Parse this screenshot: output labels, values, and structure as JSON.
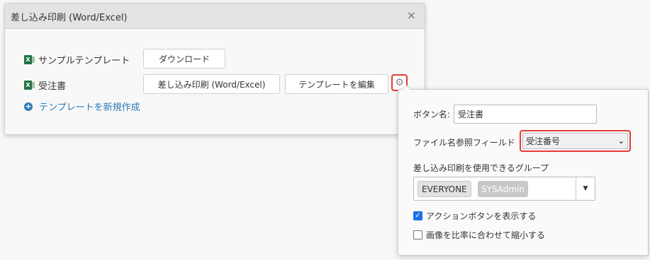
{
  "dialog": {
    "title": "差し込み印刷 (Word/Excel)",
    "close_glyph": "×",
    "rows": [
      {
        "icon": "excel-icon",
        "label": "サンプルテンプレート",
        "buttons": [
          "ダウンロード"
        ]
      },
      {
        "icon": "excel-icon",
        "label": "受注書",
        "buttons": [
          "差し込み印刷 (Word/Excel)",
          "テンプレートを編集"
        ]
      }
    ],
    "new_template_link": "テンプレートを新規作成"
  },
  "settings_popup": {
    "button_name_label": "ボタン名:",
    "button_name_value": "受注書",
    "file_field_label": "ファイル名参照フィールド",
    "file_field_value": "受注番号",
    "groups_label": "差し込み印刷を使用できるグループ",
    "groups": [
      "EVERYONE",
      "SYSAdmin"
    ],
    "show_action_button_label": "アクションボタンを表示する",
    "show_action_button_checked": true,
    "scale_image_label": "画像を比率に合わせて縮小する",
    "scale_image_checked": false
  },
  "colors": {
    "highlight_red": "#e53935",
    "link_blue": "#2a7ab8",
    "checkbox_blue": "#1a73e8",
    "excel_green": "#217346"
  }
}
